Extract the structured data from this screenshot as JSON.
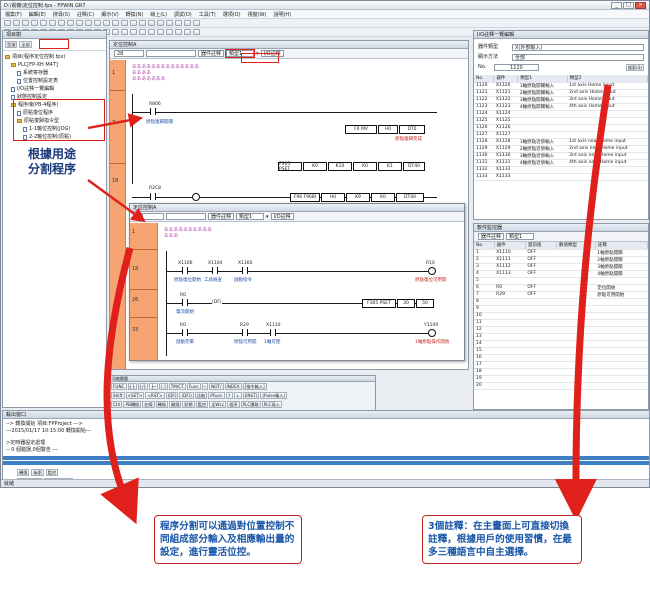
{
  "window": {
    "title": "D:\\電機\\定位控制.fpx - FPWIN GR7",
    "menu": [
      "檔案(F)",
      "編輯(E)",
      "搜尋(S)",
      "註釋(C)",
      "顯示(V)",
      "轉換(N)",
      "線上(L)",
      "調試(D)",
      "工具(T)",
      "選項(O)",
      "視窗(W)",
      "說明(H)"
    ]
  },
  "project_panel": {
    "title": "項目樹",
    "tabs": [
      "型號",
      "全部"
    ],
    "items": [
      {
        "label": "項目(程序定位控制.fpx)",
        "level": 0,
        "type": "folder"
      },
      {
        "label": "PLC[FP-XH M4T]",
        "level": 1,
        "type": "folder"
      },
      {
        "label": "系統寄存器",
        "level": 2,
        "type": "doc"
      },
      {
        "label": "位置控制設定表",
        "level": 2,
        "type": "doc"
      },
      {
        "label": "I/O註釋一覽編輯",
        "level": 1,
        "type": "doc"
      },
      {
        "label": "狀態控制設定",
        "level": 1,
        "type": "doc"
      },
      {
        "label": "程序塊(PB-4程序)",
        "level": 1,
        "type": "folder"
      },
      {
        "label": "原點復位程序",
        "level": 2,
        "type": "doc"
      },
      {
        "label": "原點復歸指令型",
        "level": 2,
        "type": "folder"
      },
      {
        "label": "1-1軸位控制(JOG)",
        "level": 3,
        "type": "doc"
      },
      {
        "label": "2-2軸位控制(原點)",
        "level": 3,
        "type": "doc"
      }
    ]
  },
  "ladder_main": {
    "tabs": [
      "定位控制0",
      "定位控制A"
    ],
    "window_title": "定位控制A",
    "toolbar": {
      "step": "28",
      "comment_mode": "器件註釋",
      "type_select": "類型1",
      "io_label": "I/O註釋"
    },
    "rungs": [
      {
        "num": "1"
      },
      {
        "num": "7",
        "contact": "R806",
        "contact_comment": "原點復歸開關",
        "boxes": [
          "F0 MV",
          "H0",
          "DT0"
        ],
        "coil_comment": "原點復歸完成"
      },
      {
        "num": "18",
        "contact": "R2C8",
        "contact_comment": "原點復歸位置",
        "boxes": [
          "F96 F96BI",
          "H0",
          "K9",
          "K0",
          "DT40"
        ]
      }
    ]
  },
  "ladder_sub": {
    "title": "定位控制A",
    "toolbar": {
      "step": "28",
      "comment_mode": "器件註釋",
      "type_select": "類型1",
      "io_label": "I/O註釋"
    },
    "rung1_comment": "原點回歸指令 ...",
    "rungs": [
      {
        "num": "1"
      },
      {
        "num": "18",
        "contacts": [
          "X1106",
          "X1104",
          "X1160"
        ],
        "comments": [
          "原點復位開始",
          "工具檢查",
          "啟動指令"
        ],
        "coil": "R10",
        "coil_comment": "原點復位可用開"
      },
      {
        "num": "26",
        "contact": "R0",
        "contact_comment": "電流開始",
        "func": "(DF)",
        "boxes": [
          "F305 PSET",
          "30",
          "50"
        ]
      },
      {
        "num": "33",
        "contacts": [
          "R0",
          "R29",
          "X1110"
        ],
        "comments": [
          "啟動完畢",
          "原點可用開",
          "1軸可使"
        ],
        "coil": "Y1100",
        "coil_comment": "1軸原點操作開始"
      }
    ]
  },
  "io_panel": {
    "title": "I/O註釋一覽編輯",
    "type_label": "器件類型",
    "type_value": "X(外部輸入)",
    "display_label": "顯示方法",
    "display_value": "全部",
    "no_label": "No.",
    "no_value": "1120",
    "search_button": "搜索(S)",
    "columns": [
      "No.",
      "器件",
      "類型1",
      "類型2"
    ],
    "rows": [
      [
        "1120",
        "X1120",
        "1軸原點開關輸入",
        "1st axis Home input"
      ],
      [
        "1121",
        "X1121",
        "2軸原點開關輸入",
        "2nd axis Home input"
      ],
      [
        "1122",
        "X1122",
        "3軸原點開關輸入",
        "3rd axis Home input"
      ],
      [
        "1123",
        "X1123",
        "4軸原點開關輸入",
        "4th axis Home input"
      ],
      [
        "1124",
        "X1124",
        "",
        ""
      ],
      [
        "1125",
        "X1125",
        "",
        ""
      ],
      [
        "1126",
        "X1126",
        "",
        ""
      ],
      [
        "1127",
        "X1127",
        "",
        ""
      ],
      [
        "1128",
        "X1128",
        "1軸原點近傍輸入",
        "1st axis near Home input"
      ],
      [
        "1129",
        "X1129",
        "2軸原點近傍輸入",
        "2nd axis near Home input"
      ],
      [
        "1130",
        "X1130",
        "3軸原點近傍輸入",
        "3rd axis near Home input"
      ],
      [
        "1131",
        "X1131",
        "4軸原點近傍輸入",
        "4th axis near Home input"
      ],
      [
        "1132",
        "X1132",
        "",
        ""
      ],
      [
        "1133",
        "X1133",
        "",
        ""
      ]
    ]
  },
  "device_panel": {
    "title": "軟件監控器",
    "comment_mode": "器件註釋",
    "type_select": "類型1",
    "columns": [
      "No.",
      "器件",
      "當前值",
      "數值類型",
      "註釋"
    ],
    "rows": [
      [
        "1",
        "X1110",
        "OFF",
        "",
        "1軸原點開關"
      ],
      [
        "2",
        "X1111",
        "OFF",
        "",
        "2軸原點開關"
      ],
      [
        "3",
        "X1112",
        "OFF",
        "",
        "3軸原點開關"
      ],
      [
        "4",
        "X1113",
        "OFF",
        "",
        "4軸原點開關"
      ],
      [
        "5",
        "",
        "",
        "",
        ""
      ],
      [
        "6",
        "R0",
        "OFF",
        "",
        "定位開始"
      ],
      [
        "7",
        "R29",
        "OFF",
        "",
        "原點可用開始"
      ],
      [
        "8",
        "",
        "",
        "",
        ""
      ],
      [
        "9",
        "",
        "",
        "",
        ""
      ],
      [
        "10",
        "",
        "",
        "",
        ""
      ],
      [
        "11",
        "",
        "",
        "",
        ""
      ],
      [
        "12",
        "",
        "",
        "",
        ""
      ],
      [
        "13",
        "",
        "",
        "",
        ""
      ],
      [
        "14",
        "",
        "",
        "",
        ""
      ],
      [
        "15",
        "",
        "",
        "",
        ""
      ],
      [
        "16",
        "",
        "",
        "",
        ""
      ],
      [
        "17",
        "",
        "",
        "",
        ""
      ],
      [
        "18",
        "",
        "",
        "",
        ""
      ],
      [
        "19",
        "",
        "",
        "",
        ""
      ],
      [
        "20",
        "",
        "",
        "",
        ""
      ]
    ]
  },
  "fkeys": {
    "row1": [
      "FUNC",
      "┤├",
      "┤/├",
      "├─",
      "[ ]",
      "TM/CT",
      "Func",
      "─",
      "NOT/",
      "INDEX",
      "[指令輸入]"
    ],
    "row2": [
      "Shift",
      "<SET>",
      "<RST>",
      "(DF)",
      "(DF/)",
      "比較",
      "PFunc",
      "↑",
      "↓",
      "(INST)",
      "(Pulse輸入)"
    ],
    "row3": [
      "Ctrl",
      "PB轉換",
      "在線",
      "轉換",
      "離線",
      "狀態",
      "監控",
      "全Wcc",
      "程序",
      "PLC讀取",
      "PLC寫入"
    ]
  },
  "output": {
    "title": "輸出窗口",
    "lines": [
      "-->  轉換開始  項目:FPProject --->",
      "---2015/01/17 10:15:00 轉換開始---",
      "",
      ">定時器設定處理",
      "-- 0 個錯誤,0個警告 ---"
    ],
    "tabs": [
      "轉換",
      "檢索",
      "監控"
    ]
  },
  "status": {
    "text": "就緒",
    "sub_tabs": [
      "輸入監控器",
      "數字輸入監控"
    ]
  },
  "annotations": {
    "left_big": "根據用途\n分割程序",
    "callout_left": "程序分割可以通過對位置控制不同組成部分輸入及相應輸出量的設定，進行靈活位控。",
    "callout_right": "3個註釋：在主畫面上可直接切換註釋，根據用戶的使用習慣，在最多三種語言中自主選擇。"
  }
}
